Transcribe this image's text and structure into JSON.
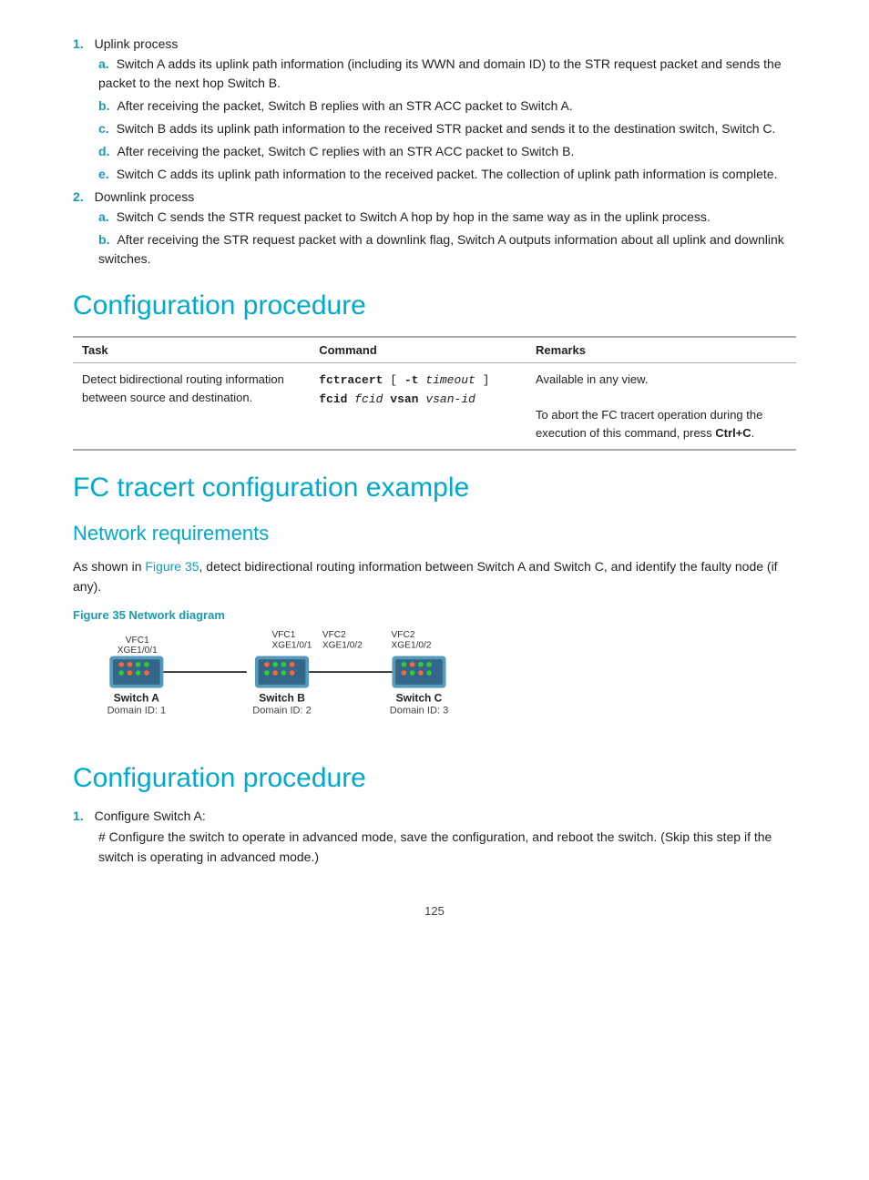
{
  "lists": {
    "uplink_process_label": "Uplink process",
    "downlink_process_label": "Downlink process",
    "uplink_items": [
      "Switch A adds its uplink path information (including its WWN and domain ID) to the STR request packet and sends the packet to the next hop Switch B.",
      "After receiving the packet, Switch B replies with an STR ACC packet to Switch A.",
      "Switch B adds its uplink path information to the received STR packet and sends it to the destination switch, Switch C.",
      "After receiving the packet, Switch C replies with an STR ACC packet to Switch B.",
      "Switch C adds its uplink path information to the received packet. The collection of uplink path information is complete."
    ],
    "downlink_items": [
      "Switch C sends the STR request packet to Switch A hop by hop in the same way as in the uplink process.",
      "After receiving the STR request packet with a downlink flag, Switch A outputs information about all uplink and downlink switches."
    ]
  },
  "config_procedure_1": {
    "title": "Configuration procedure",
    "table": {
      "headers": [
        "Task",
        "Command",
        "Remarks"
      ],
      "rows": [
        {
          "task": "Detect bidirectional routing information between source and destination.",
          "command": "fctracert [ -t timeout ] fcid fcid vsan vsan-id",
          "command_parts": {
            "bold": [
              "fctracert",
              "fcid",
              "fcid",
              "vsan"
            ],
            "italic": [
              "timeout",
              "fcid",
              "vsan-id"
            ]
          },
          "remarks_lines": [
            "Available in any view.",
            "",
            "To abort the FC tracert operation during the execution of this command, press Ctrl+C."
          ]
        }
      ]
    }
  },
  "fc_tracert": {
    "title": "FC tracert configuration example"
  },
  "network_requirements": {
    "title": "Network requirements",
    "para": "As shown in Figure 35, detect bidirectional routing information between Switch A and Switch C, and identify the faulty node (if any).",
    "figure_label": "Figure 35 Network diagram",
    "switches": [
      {
        "name": "Switch A",
        "domain": "Domain ID: 1",
        "vfc_top": "VFC1",
        "xge_top": "XGE1/0/1",
        "vfc_bot": "",
        "xge_bot": ""
      },
      {
        "name": "Switch B",
        "domain": "Domain ID: 2",
        "vfc_top": "VFC1",
        "xge_top": "XGE1/0/1",
        "vfc_top2": "VFC2",
        "xge_top2": "XGE1/0/2"
      },
      {
        "name": "Switch C",
        "domain": "Domain ID: 3",
        "vfc_top": "VFC2",
        "xge_top": "XGE1/0/2"
      }
    ]
  },
  "config_procedure_2": {
    "title": "Configuration procedure",
    "steps": [
      {
        "label": "Configure Switch A:",
        "sub_para": "# Configure the switch to operate in advanced mode, save the configuration, and reboot the switch. (Skip this step if the switch is operating in advanced mode.)"
      }
    ]
  },
  "page": {
    "number": "125"
  }
}
